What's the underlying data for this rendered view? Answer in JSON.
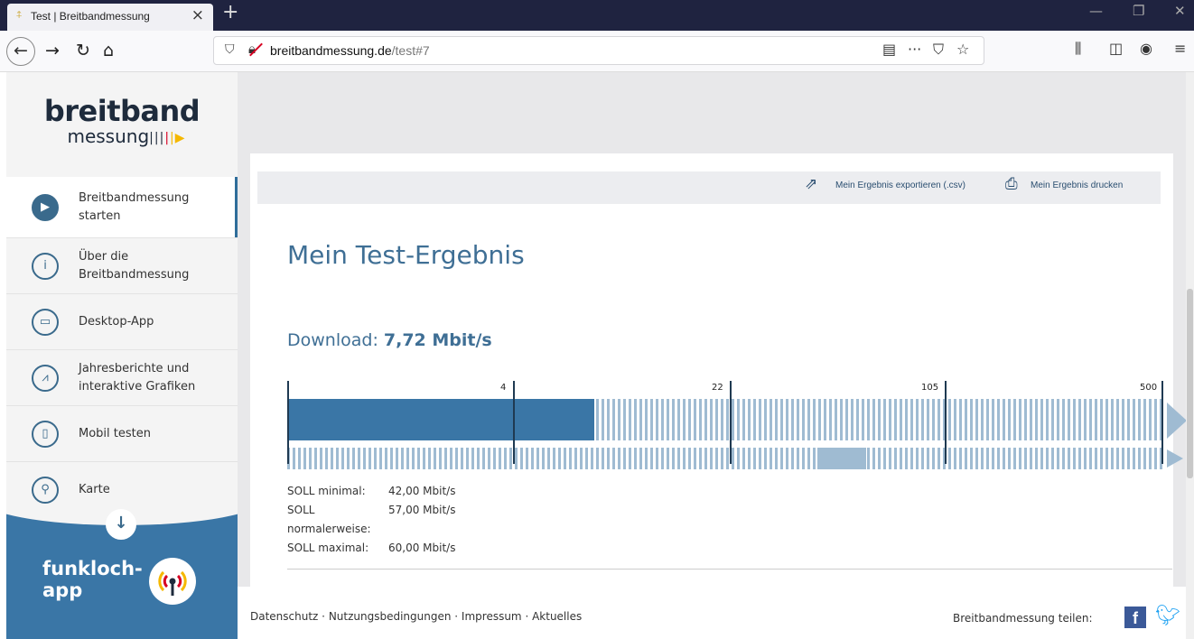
{
  "browser": {
    "tab_title": "Test | Breitbandmessung",
    "tab_favicon": "⍏",
    "tab_close": "×",
    "new_tab": "+",
    "url_domain": "breitbandmessung.de",
    "url_path": "/test#7",
    "icons": {
      "back": "back-icon",
      "forward": "forward-icon",
      "reload": "reload-icon",
      "home": "home-icon",
      "reader": "reader-icon",
      "more": "more-icon",
      "pocket": "pocket-icon",
      "bookmark": "star-icon",
      "library": "library-icon",
      "sidebar": "sidebar-icon",
      "account": "account-icon",
      "menu": "hamburger-icon"
    }
  },
  "logo": {
    "top": "breitband",
    "bottom": "messung"
  },
  "sidebar": {
    "items": [
      {
        "label": "Breitbandmessung starten",
        "icon": "play-icon",
        "active": true
      },
      {
        "label": "Über die Breitbandmessung",
        "icon": "info-icon"
      },
      {
        "label": "Desktop-App",
        "icon": "monitor-icon"
      },
      {
        "label": "Jahresberichte und interaktive Grafiken",
        "icon": "chart-icon"
      },
      {
        "label": "Mobil testen",
        "icon": "mobile-icon"
      },
      {
        "label": "Karte",
        "icon": "map-pin-icon"
      }
    ],
    "funkloch": {
      "line1": "funkloch-",
      "line2": "app"
    }
  },
  "toolbar": {
    "export_label": "Mein Ergebnis exportieren (.csv)",
    "print_label": "Mein Ergebnis drucken"
  },
  "result": {
    "title": "Mein Test-Ergebnis",
    "download_label": "Download: ",
    "download_value": "7,72 Mbit/s",
    "scale_ticks": [
      "4",
      "22",
      "105",
      "500"
    ],
    "download_fill_fraction": 0.35,
    "soll": [
      {
        "key": "SOLL minimal:",
        "value": "42,00 Mbit/s"
      },
      {
        "key": "SOLL normalerweise:",
        "value": "57,00 Mbit/s"
      },
      {
        "key": "SOLL maximal:",
        "value": "60,00 Mbit/s"
      }
    ]
  },
  "footer": {
    "links": [
      "Datenschutz",
      "Nutzungsbedingungen",
      "Impressum",
      "Aktuelles"
    ],
    "separator": " · ",
    "share_label": "Breitbandmessung teilen:"
  },
  "colors": {
    "accent": "#3a76a6",
    "dark": "#1e2b3c",
    "chrome": "#1f2340"
  }
}
